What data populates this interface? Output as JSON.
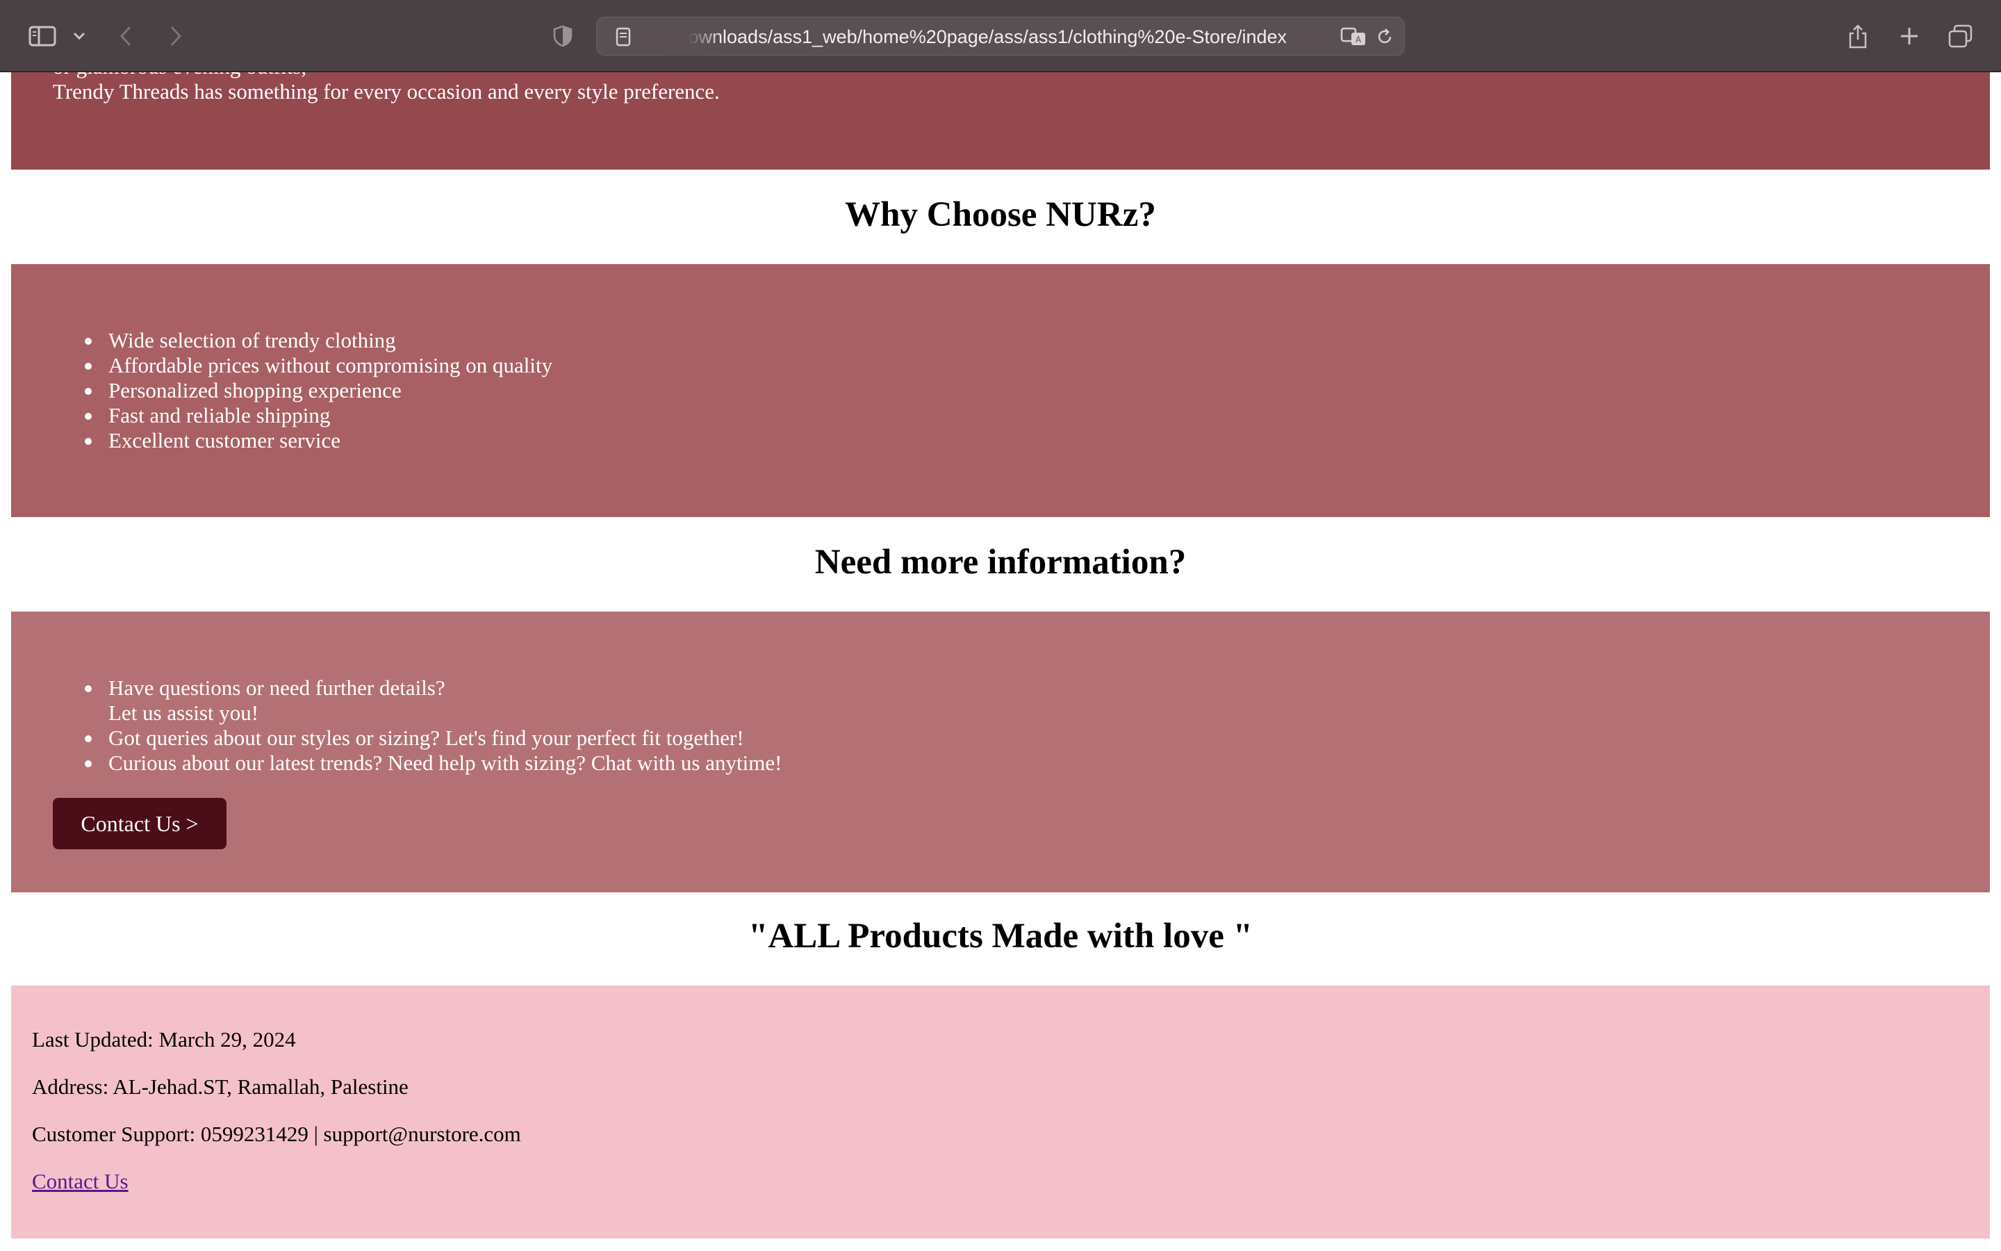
{
  "browser": {
    "url": "Downloads/ass1_web/home%20page/ass/ass1/clothing%20e-Store/index.html",
    "icons": [
      "sidebar-icon",
      "chevron-down-icon",
      "back-icon",
      "forward-icon",
      "shield-icon",
      "page-icon",
      "translate-icon",
      "reload-icon",
      "share-icon",
      "new-tab-icon",
      "tab-overview-icon"
    ]
  },
  "hero": {
    "partial_line": "or glamorous evening outfits,",
    "line": "Trendy Threads has something for every occasion and every style preference."
  },
  "why": {
    "title": "Why Choose NURz?",
    "items": [
      "Wide selection of trendy clothing",
      "Affordable prices without compromising on quality",
      "Personalized shopping experience",
      "Fast and reliable shipping",
      "Excellent customer service"
    ]
  },
  "info": {
    "title": "Need more information?",
    "items": [
      {
        "line1": "Have questions or need further details?",
        "line2": "Let us assist you!"
      },
      {
        "line1": "Got queries about our styles or sizing? Let's find your perfect fit together!"
      },
      {
        "line1": "Curious about our latest trends? Need help with sizing? Chat with us anytime!"
      }
    ],
    "button_label": "Contact Us >"
  },
  "tagline": "\"ALL Products Made with love \"",
  "footer": {
    "last_updated": "Last Updated: March 29, 2024",
    "address": "Address: AL-Jehad.ST, Ramallah, Palestine",
    "support": "Customer Support: 0599231429 | support@nurstore.com",
    "contact_link": "Contact Us"
  },
  "colors": {
    "toolbar": "#4a4145",
    "hero": "#94494f",
    "why_box": "#a86065",
    "info_box": "#b37175",
    "button": "#4b0e18",
    "footer": "#f4c1cb",
    "link": "#551a8b"
  }
}
